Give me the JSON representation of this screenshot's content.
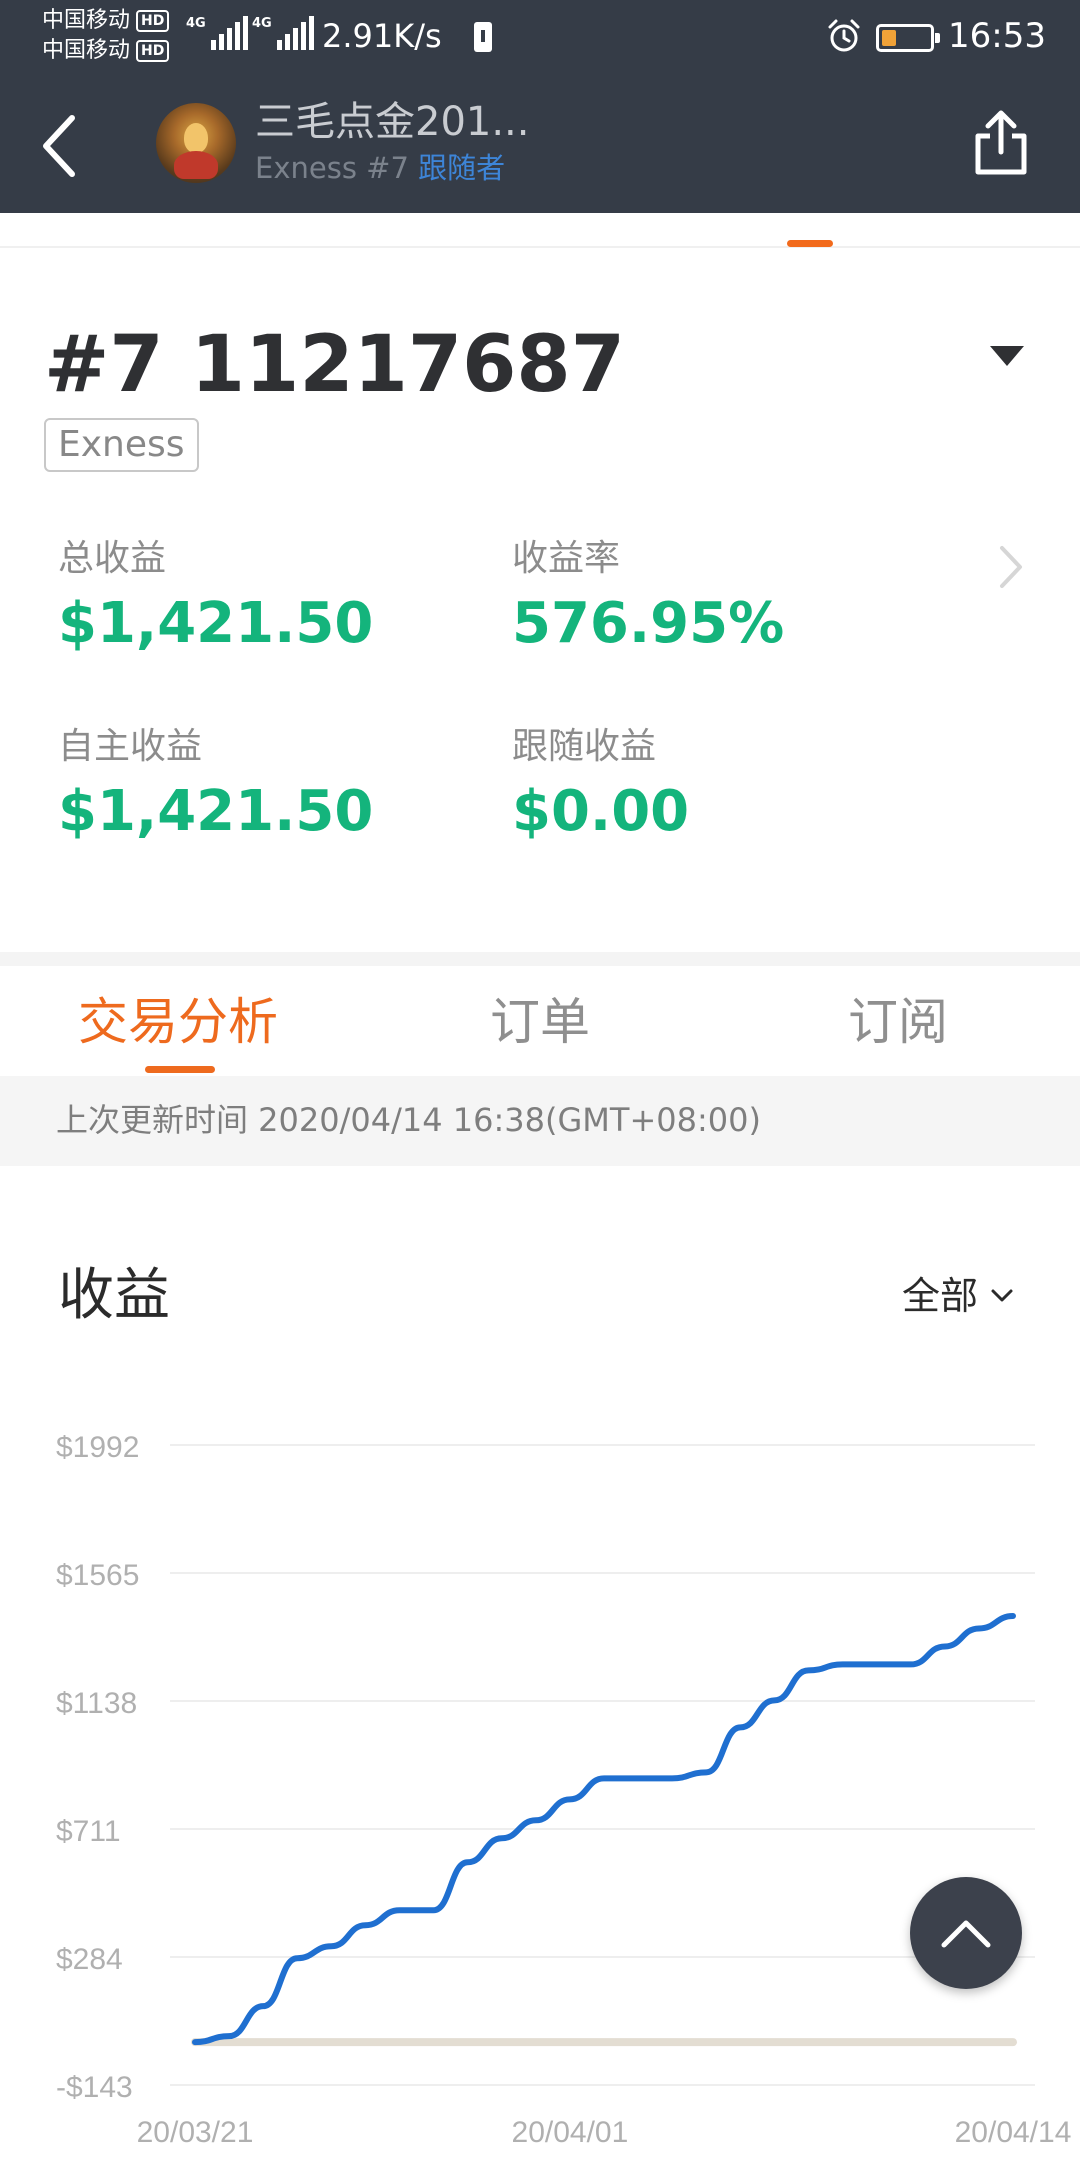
{
  "status_bar": {
    "carrier_1": "中国移动",
    "carrier_2": "中国移动",
    "hd_badge": "HD",
    "network_tag": "4G",
    "net_speed": "2.91K/s",
    "time": "16:53"
  },
  "header": {
    "title": "三毛点金201...",
    "subtitle": "Exness #7",
    "role": "跟随者"
  },
  "account": {
    "number": "#7 11217687",
    "broker": "Exness"
  },
  "metrics": {
    "total_profit_label": "总收益",
    "total_profit_value": "$1,421.50",
    "return_rate_label": "收益率",
    "return_rate_value": "576.95%",
    "self_profit_label": "自主收益",
    "self_profit_value": "$1,421.50",
    "follow_profit_label": "跟随收益",
    "follow_profit_value": "$0.00"
  },
  "tabs": [
    {
      "label": "交易分析",
      "active": true
    },
    {
      "label": "订单",
      "active": false
    },
    {
      "label": "订阅",
      "active": false
    }
  ],
  "update": {
    "text": "上次更新时间 2020/04/14 16:38(GMT+08:00)"
  },
  "section": {
    "title": "收益",
    "filter_label": "全部"
  },
  "colors": {
    "header_bg": "#353c47",
    "accent_orange": "#ee6a1e",
    "profit_green": "#14b47c",
    "line_blue": "#1f6fd0",
    "role_blue": "#3d85d8"
  },
  "chart_data": {
    "type": "line",
    "x_ticks": [
      "20/03/21",
      "20/04/01",
      "20/04/14"
    ],
    "y_ticks": [
      "$1992",
      "$1565",
      "$1138",
      "$711",
      "$284",
      "-$143"
    ],
    "ylim": [
      -143,
      1992
    ],
    "grid": true,
    "series": [
      {
        "color": "#1f6fd0",
        "x": [
          "20/03/21",
          "20/03/22",
          "20/03/23",
          "20/03/24",
          "20/03/25",
          "20/03/26",
          "20/03/27",
          "20/03/28",
          "20/03/29",
          "20/03/30",
          "20/03/31",
          "20/04/01",
          "20/04/02",
          "20/04/03",
          "20/04/04",
          "20/04/05",
          "20/04/06",
          "20/04/07",
          "20/04/08",
          "20/04/09",
          "20/04/10",
          "20/04/11",
          "20/04/12",
          "20/04/13",
          "20/04/14"
        ],
        "values": [
          0,
          20,
          120,
          280,
          320,
          390,
          440,
          440,
          600,
          680,
          740,
          810,
          880,
          880,
          880,
          900,
          1050,
          1140,
          1240,
          1260,
          1260,
          1260,
          1320,
          1380,
          1421.5
        ]
      },
      {
        "color": "#e3ddd2",
        "x": [
          "20/03/21",
          "20/04/14"
        ],
        "values": [
          0,
          0
        ]
      }
    ]
  }
}
